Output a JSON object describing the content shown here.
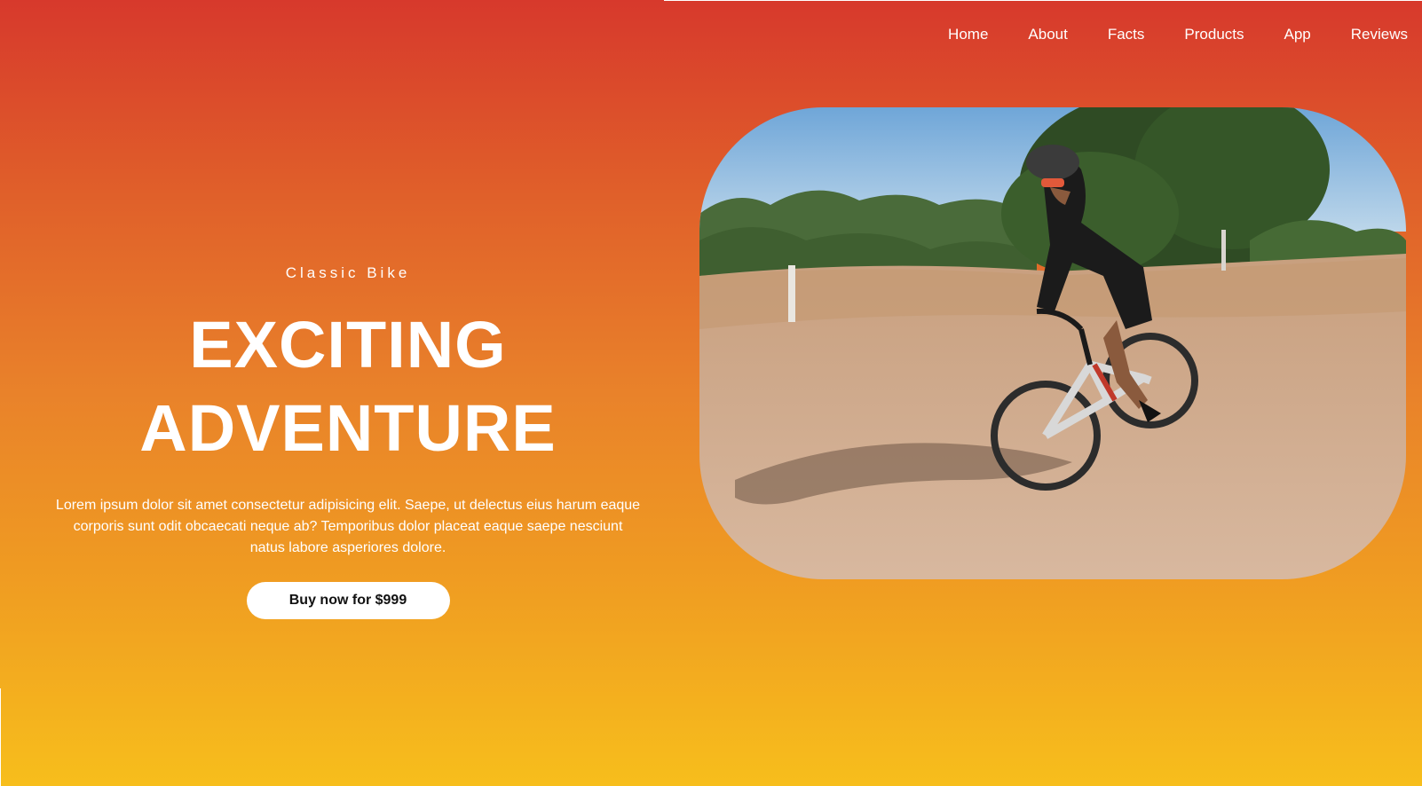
{
  "nav": {
    "items": [
      {
        "label": "Home"
      },
      {
        "label": "About"
      },
      {
        "label": "Facts"
      },
      {
        "label": "Products"
      },
      {
        "label": "App"
      },
      {
        "label": "Reviews"
      }
    ]
  },
  "hero": {
    "eyebrow": "Classic Bike",
    "headline_line1": "EXCITING",
    "headline_line2": "ADVENTURE",
    "description": "Lorem ipsum dolor sit amet consectetur adipisicing elit. Saepe, ut delectus eius harum eaque corporis sunt odit obcaecati neque ab? Temporibus dolor placeat eaque saepe nesciunt natus labore asperiores dolore.",
    "cta_label": "Buy now for $999"
  },
  "colors": {
    "gradient_top": "#d7392c",
    "gradient_bottom": "#f7be1c",
    "text": "#ffffff",
    "button_bg": "#ffffff",
    "button_text": "#111111"
  }
}
